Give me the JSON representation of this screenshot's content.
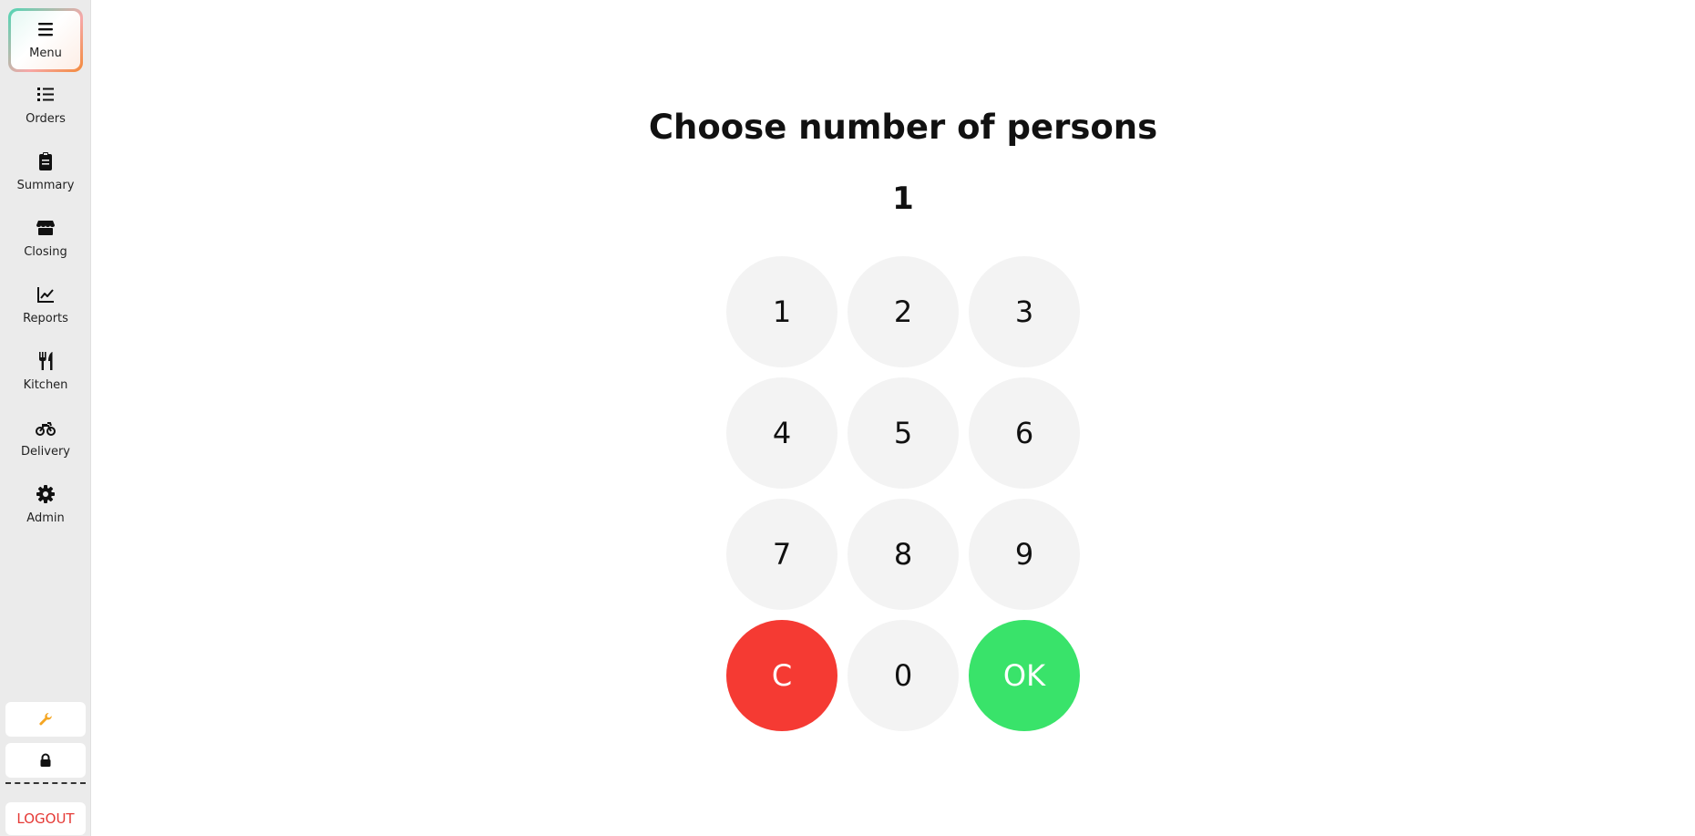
{
  "sidebar": {
    "items": [
      {
        "label": "Menu",
        "icon": "hamburger-icon",
        "active": true
      },
      {
        "label": "Orders",
        "icon": "list-icon"
      },
      {
        "label": "Summary",
        "icon": "clipboard-icon"
      },
      {
        "label": "Closing",
        "icon": "store-icon"
      },
      {
        "label": "Reports",
        "icon": "chart-line-icon"
      },
      {
        "label": "Kitchen",
        "icon": "utensils-icon"
      },
      {
        "label": "Delivery",
        "icon": "motorcycle-icon"
      },
      {
        "label": "Admin",
        "icon": "gear-icon"
      }
    ],
    "tools": [
      {
        "icon": "wrench-icon",
        "color": "#f5a623"
      },
      {
        "icon": "lock-icon",
        "color": "#111111"
      }
    ],
    "divider_text": "----------",
    "logout_label": "LOGOUT"
  },
  "main": {
    "title": "Choose number of persons",
    "display_value": "1",
    "keys": [
      "1",
      "2",
      "3",
      "4",
      "5",
      "6",
      "7",
      "8",
      "9",
      "C",
      "0",
      "OK"
    ]
  },
  "colors": {
    "clear": "#f53a33",
    "ok": "#39e36a",
    "key_bg": "#f3f3f3",
    "sidebar_bg": "#ebebeb",
    "logout_text": "#e53935"
  }
}
